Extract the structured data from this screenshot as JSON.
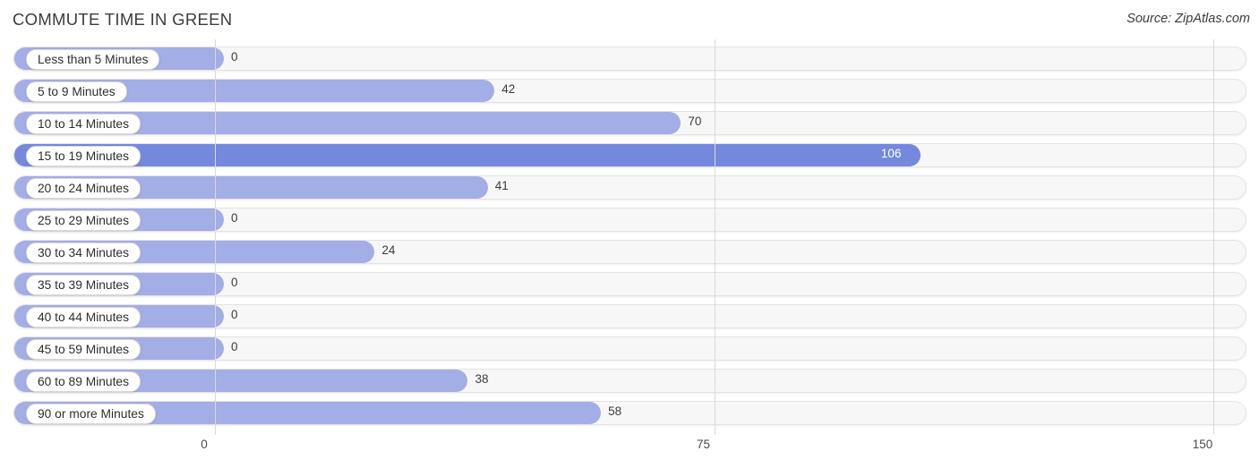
{
  "header": {
    "title": "COMMUTE TIME IN GREEN",
    "source": "Source: ZipAtlas.com"
  },
  "chart_data": {
    "type": "bar",
    "orientation": "horizontal",
    "title": "COMMUTE TIME IN GREEN",
    "xlabel": "",
    "ylabel": "",
    "xlim": [
      0,
      150
    ],
    "ticks": [
      0,
      75,
      150
    ],
    "tick_labels": [
      "0",
      "75",
      "150"
    ],
    "grid": true,
    "legend": false,
    "categories": [
      "Less than 5 Minutes",
      "5 to 9 Minutes",
      "10 to 14 Minutes",
      "15 to 19 Minutes",
      "20 to 24 Minutes",
      "25 to 29 Minutes",
      "30 to 34 Minutes",
      "35 to 39 Minutes",
      "40 to 44 Minutes",
      "45 to 59 Minutes",
      "60 to 89 Minutes",
      "90 or more Minutes"
    ],
    "values": [
      0,
      42,
      70,
      106,
      41,
      0,
      24,
      0,
      0,
      0,
      38,
      58
    ],
    "value_labels": [
      "0",
      "42",
      "70",
      "106",
      "41",
      "0",
      "24",
      "0",
      "0",
      "0",
      "38",
      "58"
    ],
    "highlight_index": 3,
    "colors": {
      "bar": "#a3ade6",
      "bar_highlight": "#7489dd",
      "track": "#f7f7f7",
      "track_border": "#e3e3e3",
      "gridline": "#d9d9d9",
      "text": "#3c3c3c",
      "value_inside": "#ffffff"
    }
  }
}
